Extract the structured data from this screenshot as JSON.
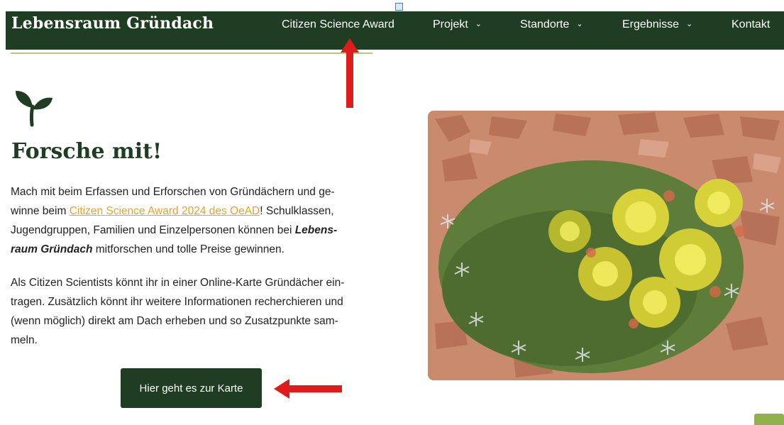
{
  "header": {
    "brand": "Lebensraum Gründach",
    "nav": [
      {
        "label": "Citizen Science Award",
        "has_dropdown": false
      },
      {
        "label": "Projekt",
        "has_dropdown": true
      },
      {
        "label": "Standorte",
        "has_dropdown": true
      },
      {
        "label": "Ergebnisse",
        "has_dropdown": true
      },
      {
        "label": "Kontakt",
        "has_dropdown": false
      }
    ],
    "chevron": "⌄"
  },
  "main": {
    "icon": "sprout-icon",
    "title": "Forsche mit!",
    "p1": {
      "t1": "Mach mit beim Erfassen und Erforschen von Gründächern  und ge-",
      "t2": "winne beim ",
      "link": "Citizen Science Award 2024 des OeAD",
      "t3": "! Schulklassen,",
      "t4": "Jugendgruppen, Familien und Einzelpersonen können bei ",
      "em1": "Lebens-",
      "em2": "raum Gründach",
      "t5": " mitforschen und tolle Preise gewinnen."
    },
    "p2": [
      "Als Citizen Scientists könnt ihr in einer Online-Karte Gründächer ein-",
      "tragen. Zusätzlich könnt ihr weitere Informationen recherchieren und",
      "(wenn möglich) direkt am Dach erheben und so Zusatzpunkte sam-",
      "meln."
    ],
    "button": "Hier geht es zur Karte"
  },
  "colors": {
    "nav_bg": "#1f3d22",
    "link": "#e5a32b",
    "annotation_arrow": "#e01b1b",
    "accent_green": "#8fb24a"
  }
}
